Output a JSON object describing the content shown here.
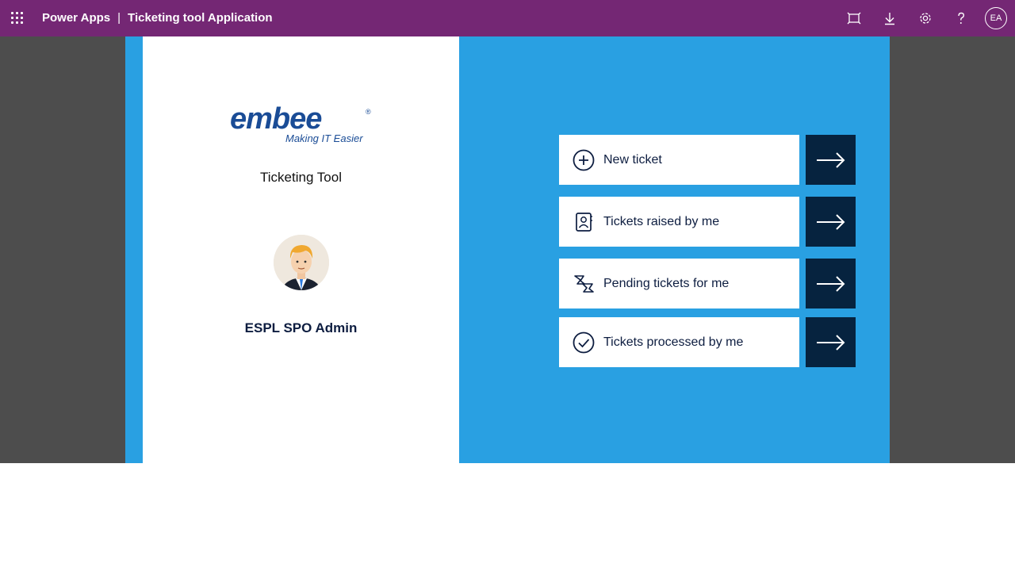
{
  "header": {
    "app_name": "Power Apps",
    "separator": "|",
    "app_title": "Ticketing tool Application",
    "user_initials": "EA",
    "icons": [
      "waffle-icon",
      "fit-to-screen-icon",
      "download-icon",
      "settings-gear-icon",
      "help-icon"
    ]
  },
  "left": {
    "logo_text": "embee",
    "logo_registered": "®",
    "logo_tagline": "Making IT Easier",
    "tool_title": "Ticketing Tool",
    "user_name": "ESPL SPO Admin"
  },
  "menu": [
    {
      "label": "New ticket",
      "icon": "add-circle-icon"
    },
    {
      "label": "Tickets raised by me",
      "icon": "contact-card-icon"
    },
    {
      "label": "Pending tickets for me",
      "icon": "switch-icon"
    },
    {
      "label": "Tickets processed by me",
      "icon": "check-circle-icon"
    }
  ],
  "colors": {
    "header": "#742774",
    "canvas": "#29a0e2",
    "arrow_button": "#06233f",
    "logo_blue": "#1a4c96",
    "logo_red": "#d8262c"
  }
}
